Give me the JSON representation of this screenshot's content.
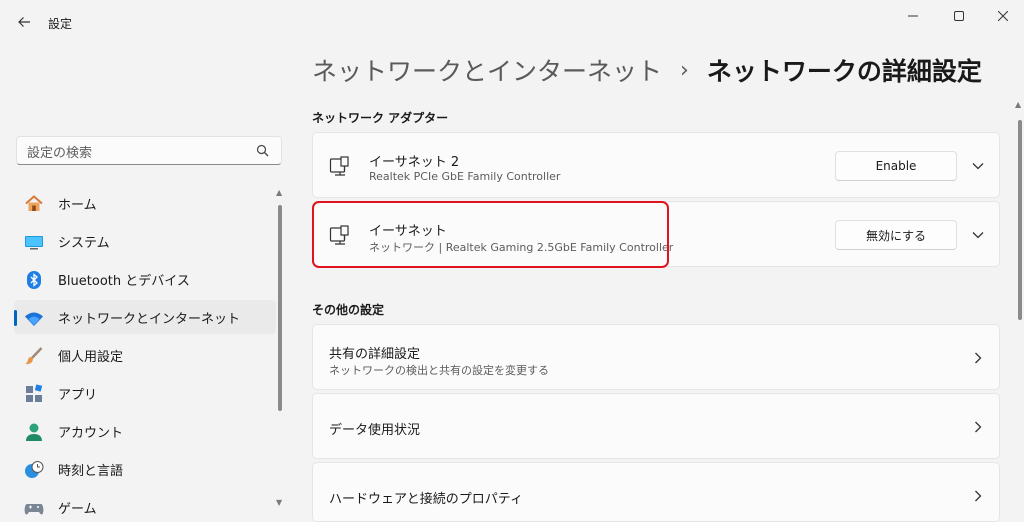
{
  "window": {
    "title": "設定"
  },
  "search": {
    "placeholder": "設定の検索"
  },
  "sidebar": {
    "items": [
      {
        "label": "ホーム",
        "icon": "home-icon"
      },
      {
        "label": "システム",
        "icon": "system-icon"
      },
      {
        "label": "Bluetooth とデバイス",
        "icon": "bluetooth-icon"
      },
      {
        "label": "ネットワークとインターネット",
        "icon": "wifi-icon",
        "active": true
      },
      {
        "label": "個人用設定",
        "icon": "brush-icon"
      },
      {
        "label": "アプリ",
        "icon": "apps-icon"
      },
      {
        "label": "アカウント",
        "icon": "account-icon"
      },
      {
        "label": "時刻と言語",
        "icon": "clock-globe-icon"
      },
      {
        "label": "ゲーム",
        "icon": "gamepad-icon"
      }
    ]
  },
  "breadcrumb": {
    "parent": "ネットワークとインターネット",
    "separator": "›",
    "current": "ネットワークの詳細設定"
  },
  "adapters": {
    "section_title": "ネットワーク アダプター",
    "items": [
      {
        "name": "イーサネット 2",
        "description": "Realtek PCIe GbE Family Controller",
        "button": "Enable"
      },
      {
        "name": "イーサネット",
        "description": "ネットワーク | Realtek Gaming 2.5GbE Family Controller",
        "button": "無効にする"
      }
    ]
  },
  "other": {
    "section_title": "その他の設定",
    "items": [
      {
        "title": "共有の詳細設定",
        "subtitle": "ネットワークの検出と共有の設定を変更する"
      },
      {
        "title": "データ使用状況"
      },
      {
        "title": "ハードウェアと接続のプロパティ"
      }
    ]
  },
  "colors": {
    "accent": "#0067c0",
    "highlight": "#e0141e",
    "background": "#f3f3f3"
  }
}
